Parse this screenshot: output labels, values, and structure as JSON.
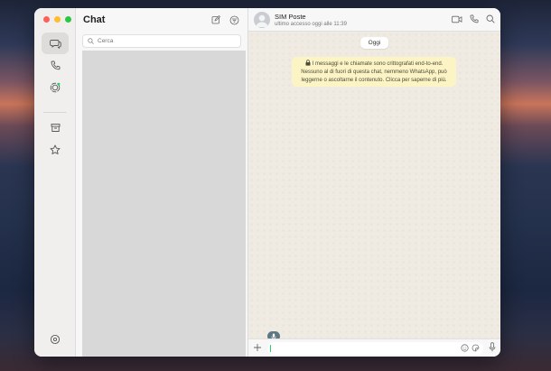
{
  "sidebar": {
    "title": "Chat",
    "search": {
      "placeholder": "Cerca",
      "value": ""
    }
  },
  "conversation": {
    "contact_name": "SIM Poste",
    "contact_status": "ultimo accesso oggi alle 11:39",
    "date_label": "Oggi",
    "encryption_notice": "I messaggi e le chiamate sono crittografati end-to-end. Nessuno al di fuori di questa chat, nemmeno WhatsApp, può leggerne o ascoltarne il contenuto. Clicca per saperne di più.",
    "message_input": {
      "placeholder": "",
      "value": ""
    }
  },
  "icons": {
    "rail": [
      "chats-icon",
      "calls-icon",
      "status-icon",
      "archive-icon",
      "starred-icon",
      "settings-icon"
    ],
    "header": [
      "new-chat-icon",
      "filter-icon"
    ],
    "conversation_header": [
      "video-call-icon",
      "voice-call-icon",
      "search-icon"
    ],
    "composer": [
      "plus-icon",
      "emoji-icon",
      "sticker-icon",
      "microphone-icon"
    ]
  },
  "colors": {
    "notice_bg": "#fcf4c4",
    "chat_bg": "#efeae2",
    "accent": "#25d366"
  }
}
